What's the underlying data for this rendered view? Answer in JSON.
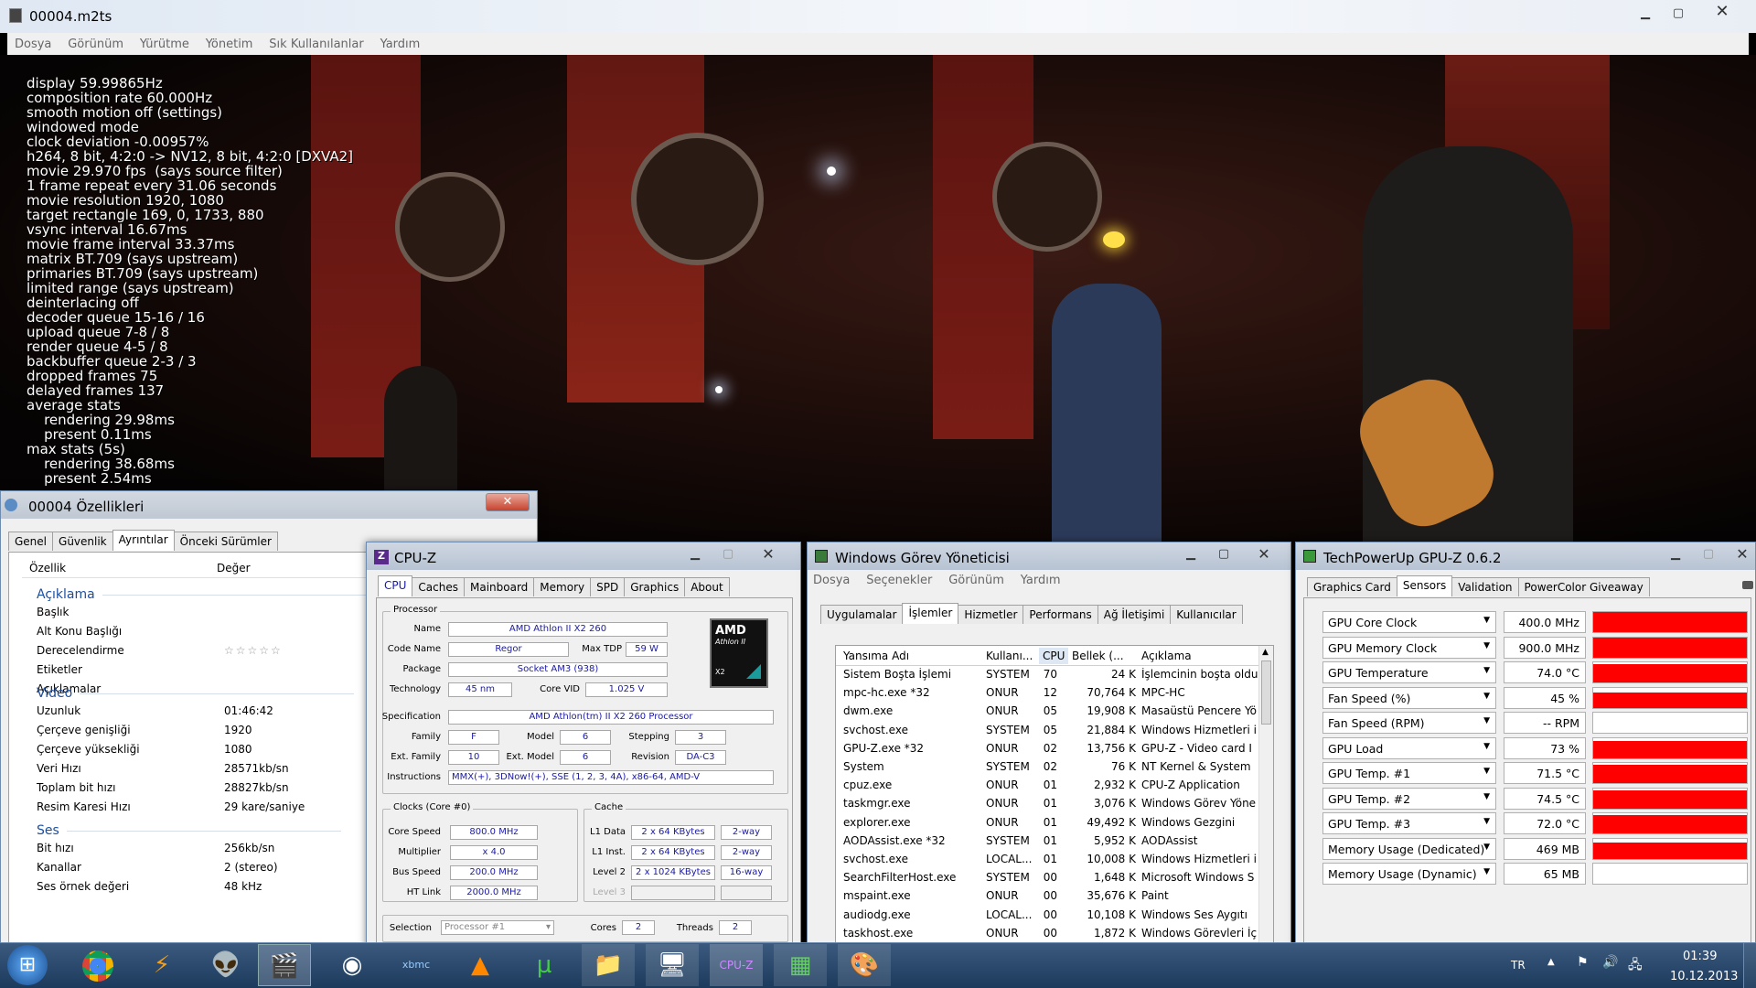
{
  "player": {
    "title": "00004.m2ts",
    "menu": [
      "Dosya",
      "Görünüm",
      "Yürütme",
      "Yönetim",
      "Sık Kullanılanlar",
      "Yardım"
    ],
    "stats": [
      "display 59.99865Hz",
      "composition rate 60.000Hz",
      "smooth motion off (settings)",
      "windowed mode",
      "clock deviation -0.00957%",
      "h264, 8 bit, 4:2:0 -> NV12, 8 bit, 4:2:0 [DXVA2]",
      "movie 29.970 fps  (says source filter)",
      "1 frame repeat every 31.06 seconds",
      "movie resolution 1920, 1080",
      "target rectangle 169, 0, 1733, 880",
      "vsync interval 16.67ms",
      "movie frame interval 33.37ms",
      "matrix BT.709 (says upstream)",
      "primaries BT.709 (says upstream)",
      "limited range (says upstream)",
      "deinterlacing off",
      "decoder queue 15-16 / 16",
      "upload queue 7-8 / 8",
      "render queue 4-5 / 8",
      "backbuffer queue 2-3 / 3",
      "dropped frames 75",
      "delayed frames 137",
      "average stats",
      "    rendering 29.98ms",
      "    present 0.11ms",
      "max stats (5s)",
      "    rendering 38.68ms",
      "    present 2.54ms"
    ]
  },
  "props": {
    "title": "00004 Özellikleri",
    "tabs": [
      "Genel",
      "Güvenlik",
      "Ayrıntılar",
      "Önceki Sürümler"
    ],
    "active_tab": "Ayrıntılar",
    "col_prop": "Özellik",
    "col_val": "Değer",
    "sections": {
      "desc": "Açıklama",
      "video": "Video",
      "audio": "Ses"
    },
    "desc_rows": [
      [
        "Başlık",
        ""
      ],
      [
        "Alt Konu Başlığı",
        ""
      ],
      [
        "Derecelendirme",
        "☆☆☆☆☆"
      ],
      [
        "Etiketler",
        ""
      ],
      [
        "Açıklamalar",
        ""
      ]
    ],
    "video_rows": [
      [
        "Uzunluk",
        "01:46:42"
      ],
      [
        "Çerçeve genişliği",
        "1920"
      ],
      [
        "Çerçeve yüksekliği",
        "1080"
      ],
      [
        "Veri Hızı",
        "28571kb/sn"
      ],
      [
        "Toplam bit hızı",
        "28827kb/sn"
      ],
      [
        "Resim Karesi Hızı",
        "29 kare/saniye"
      ]
    ],
    "audio_rows": [
      [
        "Bit hızı",
        "256kb/sn"
      ],
      [
        "Kanallar",
        "2 (stereo)"
      ],
      [
        "Ses örnek değeri",
        "48 kHz"
      ]
    ]
  },
  "cpuz": {
    "title": "CPU-Z",
    "tabs": [
      "CPU",
      "Caches",
      "Mainboard",
      "Memory",
      "SPD",
      "Graphics",
      "About"
    ],
    "active_tab": "CPU",
    "processor_label": "Processor",
    "name_l": "Name",
    "name": "AMD Athlon II X2 260",
    "codename_l": "Code Name",
    "codename": "Regor",
    "tdp_l": "Max TDP",
    "tdp": "59 W",
    "package_l": "Package",
    "package": "Socket AM3 (938)",
    "tech_l": "Technology",
    "tech": "45 nm",
    "vid_l": "Core VID",
    "vid": "1.025 V",
    "spec_l": "Specification",
    "spec": "AMD Athlon(tm) II X2 260 Processor",
    "family_l": "Family",
    "family": "F",
    "model_l": "Model",
    "model": "6",
    "stepping_l": "Stepping",
    "stepping": "3",
    "extfam_l": "Ext. Family",
    "extfam": "10",
    "extmodel_l": "Ext. Model",
    "extmodel": "6",
    "revision_l": "Revision",
    "revision": "DA-C3",
    "instr_l": "Instructions",
    "instr": "MMX(+), 3DNow!(+), SSE (1, 2, 3, 4A), x86-64, AMD-V",
    "logo_brand": "AMD",
    "logo_model": "Athlon II",
    "logo_x2": "X2",
    "clocks_label": "Clocks (Core #0)",
    "corespeed_l": "Core Speed",
    "corespeed": "800.0 MHz",
    "mult_l": "Multiplier",
    "mult": "x 4.0",
    "bus_l": "Bus Speed",
    "bus": "200.0 MHz",
    "ht_l": "HT Link",
    "ht": "2000.0 MHz",
    "cache_label": "Cache",
    "l1d_l": "L1 Data",
    "l1d": "2 x 64 KBytes",
    "l1d_w": "2-way",
    "l1i_l": "L1 Inst.",
    "l1i": "2 x 64 KBytes",
    "l1i_w": "2-way",
    "l2_l": "Level 2",
    "l2": "2 x 1024 KBytes",
    "l2_w": "16-way",
    "l3_l": "Level 3",
    "selection_l": "Selection",
    "selection": "Processor #1",
    "cores_l": "Cores",
    "cores": "2",
    "threads_l": "Threads",
    "threads": "2"
  },
  "taskmgr": {
    "title": "Windows Görev Yöneticisi",
    "menu": [
      "Dosya",
      "Seçenekler",
      "Görünüm",
      "Yardım"
    ],
    "tabs": [
      "Uygulamalar",
      "İşlemler",
      "Hizmetler",
      "Performans",
      "Ağ İletişimi",
      "Kullanıcılar"
    ],
    "active_tab": "İşlemler",
    "cols": [
      "Yansıma Adı",
      "Kullanı...",
      "CPU",
      "Bellek (...",
      "Açıklama"
    ],
    "rows": [
      [
        "Sistem Boşta İşlemi",
        "SYSTEM",
        "70",
        "24 K",
        "İşlemcinin boşta oldu"
      ],
      [
        "mpc-hc.exe *32",
        "ONUR",
        "12",
        "70,764 K",
        "MPC-HC"
      ],
      [
        "dwm.exe",
        "ONUR",
        "05",
        "19,908 K",
        "Masaüstü Pencere Yö"
      ],
      [
        "svchost.exe",
        "SYSTEM",
        "05",
        "21,884 K",
        "Windows Hizmetleri i"
      ],
      [
        "GPU-Z.exe *32",
        "ONUR",
        "02",
        "13,756 K",
        "GPU-Z - Video card I"
      ],
      [
        "System",
        "SYSTEM",
        "02",
        "76 K",
        "NT Kernel & System"
      ],
      [
        "cpuz.exe",
        "ONUR",
        "01",
        "2,932 K",
        "CPU-Z Application"
      ],
      [
        "taskmgr.exe",
        "ONUR",
        "01",
        "3,076 K",
        "Windows Görev Yöne"
      ],
      [
        "explorer.exe",
        "ONUR",
        "01",
        "49,492 K",
        "Windows Gezgini"
      ],
      [
        "AODAssist.exe *32",
        "SYSTEM",
        "01",
        "5,952 K",
        "AODAssist"
      ],
      [
        "svchost.exe",
        "LOCAL...",
        "01",
        "10,008 K",
        "Windows Hizmetleri i"
      ],
      [
        "SearchFilterHost.exe",
        "SYSTEM",
        "00",
        "1,648 K",
        "Microsoft Windows S"
      ],
      [
        "mspaint.exe",
        "ONUR",
        "00",
        "35,676 K",
        "Paint"
      ],
      [
        "audiodg.exe",
        "LOCAL...",
        "00",
        "10,108 K",
        "Windows Ses Aygıtı"
      ],
      [
        "taskhost.exe",
        "ONUR",
        "00",
        "1,872 K",
        "Windows Görevleri İç"
      ]
    ]
  },
  "gpuz": {
    "title": "TechPowerUp GPU-Z 0.6.2",
    "tabs": [
      "Graphics Card",
      "Sensors",
      "Validation",
      "PowerColor Giveaway"
    ],
    "active_tab": "Sensors",
    "sensors": [
      {
        "name": "GPU Core Clock",
        "value": "400.0 MHz",
        "level": 1.0
      },
      {
        "name": "GPU Memory Clock",
        "value": "900.0 MHz",
        "level": 1.0
      },
      {
        "name": "GPU Temperature",
        "value": "74.0 °C",
        "level": 0.9
      },
      {
        "name": "Fan Speed (%)",
        "value": "45 %",
        "level": 0.75
      },
      {
        "name": "Fan Speed (RPM)",
        "value": "-- RPM",
        "level": 0
      },
      {
        "name": "GPU Load",
        "value": "73 %",
        "level": 0.85
      },
      {
        "name": "GPU Temp. #1",
        "value": "71.5 °C",
        "level": 0.9
      },
      {
        "name": "GPU Temp. #2",
        "value": "74.5 °C",
        "level": 0.9
      },
      {
        "name": "GPU Temp. #3",
        "value": "72.0 °C",
        "level": 0.9
      },
      {
        "name": "Memory Usage (Dedicated)",
        "value": "469 MB",
        "level": 0.8
      },
      {
        "name": "Memory Usage (Dynamic)",
        "value": "65 MB",
        "level": 0
      }
    ]
  },
  "taskbar": {
    "lang": "TR",
    "time": "01:39",
    "date": "10.12.2013"
  },
  "colors": {
    "taskbar": "#1c3a5c",
    "accent": "#1d4f9f",
    "graph": "#ff0000"
  }
}
